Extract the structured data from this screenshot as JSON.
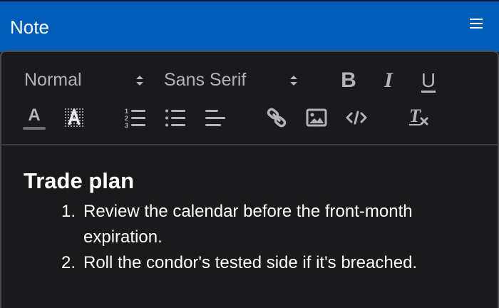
{
  "window": {
    "title": "Note",
    "menu_icon": "hamburger-menu-icon"
  },
  "toolbar": {
    "heading_select": {
      "value": "Normal"
    },
    "font_select": {
      "value": "Sans Serif"
    },
    "buttons": [
      {
        "name": "bold",
        "label": "B",
        "icon": "bold-icon"
      },
      {
        "name": "italic",
        "label": "I",
        "icon": "italic-icon"
      },
      {
        "name": "underline",
        "label": "U",
        "icon": "underline-icon"
      },
      {
        "name": "text-color",
        "label": "A",
        "icon": "text-color-icon"
      },
      {
        "name": "background-color",
        "label": "A",
        "icon": "highlight-color-icon"
      },
      {
        "name": "ordered-list",
        "icon": "ordered-list-icon"
      },
      {
        "name": "bullet-list",
        "icon": "bullet-list-icon"
      },
      {
        "name": "align",
        "icon": "align-left-icon"
      },
      {
        "name": "link",
        "icon": "link-icon"
      },
      {
        "name": "image",
        "icon": "image-icon"
      },
      {
        "name": "code",
        "icon": "code-icon"
      },
      {
        "name": "clear-format",
        "label": "T",
        "icon": "clear-format-icon"
      }
    ]
  },
  "editor": {
    "heading": "Trade plan",
    "list": [
      {
        "num": "1.",
        "text": "Review the calendar before the front-month expiration."
      },
      {
        "num": "2.",
        "text": "Roll the condor's tested side if it's breached."
      }
    ]
  },
  "colors": {
    "header": "#005cb9",
    "panel": "#1a1a1c",
    "toolbar_icon": "#b4b4b8",
    "text": "#ffffff"
  }
}
